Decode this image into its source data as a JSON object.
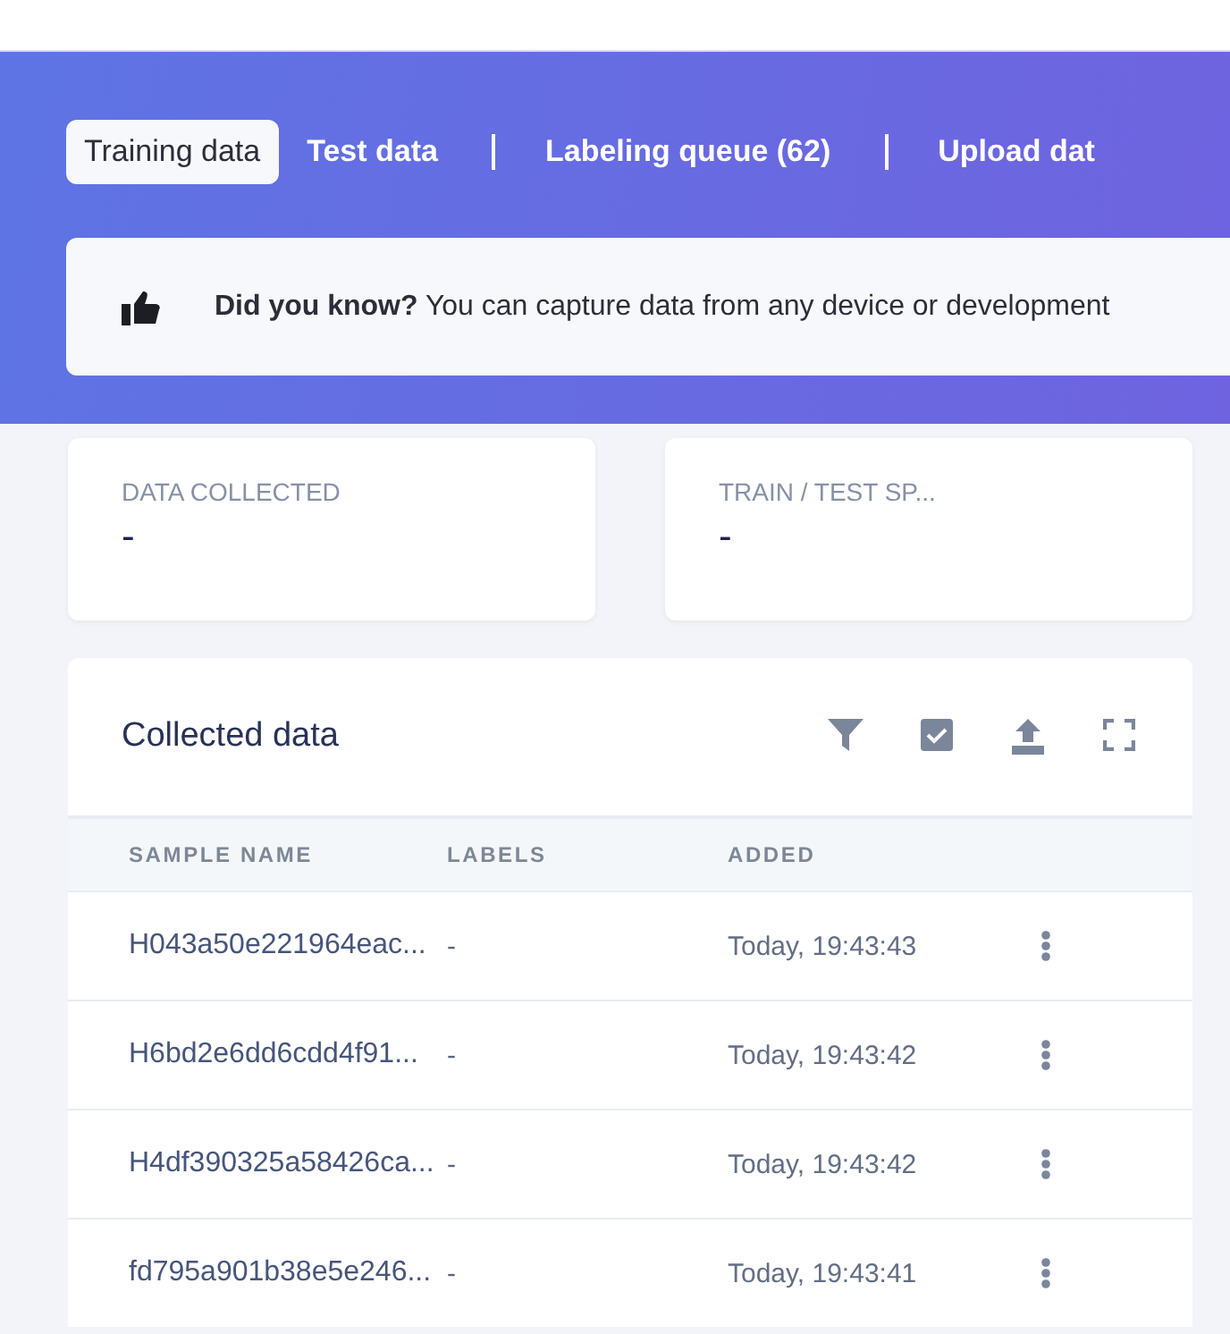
{
  "tabs": [
    {
      "label": "Training data",
      "selected": true
    },
    {
      "label": "Test data",
      "selected": false
    },
    {
      "label": "Labeling queue (62)",
      "selected": false
    },
    {
      "label": "Upload dat",
      "selected": false
    }
  ],
  "tip": {
    "text": "**Did you know?** You can capture data from any device or development"
  },
  "stats": [
    {
      "label": "DATA COLLECTED",
      "value": "-"
    },
    {
      "label": "TRAIN / TEST SP...",
      "value": "-"
    }
  ],
  "table": {
    "title": "Collected data",
    "columns": [
      "SAMPLE NAME",
      "LABELS",
      "ADDED"
    ],
    "rows": [
      {
        "name": "H043a50e221964eac...",
        "labels": "-",
        "added": "Today, 19:43:43"
      },
      {
        "name": "H6bd2e6dd6cdd4f91...",
        "labels": "-",
        "added": "Today, 19:43:42"
      },
      {
        "name": "H4df390325a58426ca...",
        "labels": "-",
        "added": "Today, 19:43:42"
      },
      {
        "name": "fd795a901b38e5e246...",
        "labels": "-",
        "added": "Today, 19:43:41"
      }
    ]
  }
}
